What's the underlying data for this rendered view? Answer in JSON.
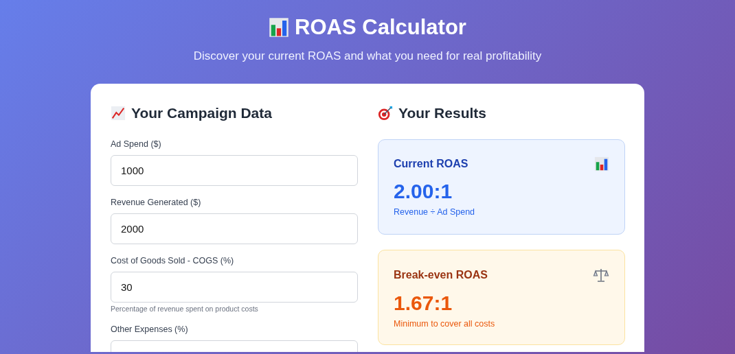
{
  "header": {
    "title": "ROAS Calculator",
    "subtitle": "Discover your current ROAS and what you need for real profitability"
  },
  "inputs_panel": {
    "title": "Your Campaign Data",
    "fields": [
      {
        "label": "Ad Spend ($)",
        "value": "1000"
      },
      {
        "label": "Revenue Generated ($)",
        "value": "2000"
      },
      {
        "label": "Cost of Goods Sold - COGS (%)",
        "value": "30",
        "hint": "Percentage of revenue spent on product costs"
      },
      {
        "label": "Other Expenses (%)"
      }
    ]
  },
  "results_panel": {
    "title": "Your Results",
    "cards": [
      {
        "kind": "current",
        "title": "Current ROAS",
        "value": "2.00:1",
        "note": "Revenue ÷ Ad Spend"
      },
      {
        "kind": "breakeven",
        "title": "Break-even ROAS",
        "value": "1.67:1",
        "note": "Minimum to cover all costs"
      }
    ]
  }
}
